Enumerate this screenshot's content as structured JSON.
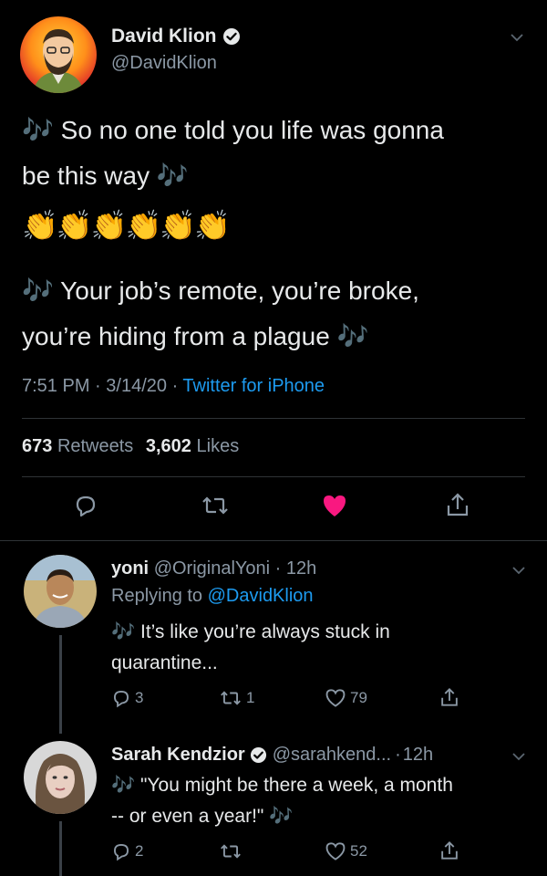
{
  "main_tweet": {
    "author_name": "David Klion",
    "author_handle": "@DavidKlion",
    "line1": "🎶 So no one told you life was gonna",
    "line2": "be this way 🎶",
    "claps": "👏👏👏👏👏👏",
    "line3": "🎶 Your job’s remote, you’re broke,",
    "line4": "you’re hiding from a plague 🎶",
    "time": "7:51 PM",
    "date": "3/14/20",
    "source": "Twitter for iPhone",
    "retweets_count": "673",
    "retweets_label": "Retweets",
    "likes_count": "3,602",
    "likes_label": "Likes"
  },
  "replies": [
    {
      "author_name": "yoni",
      "author_handle": "@OriginalYoni",
      "time": "12h",
      "replying_prefix": "Replying to",
      "replying_to": "@DavidKlion",
      "line1": "🎶 It’s like you’re always stuck in",
      "line2": "quarantine...",
      "reply_count": "3",
      "retweet_count": "1",
      "like_count": "79"
    },
    {
      "author_name": "Sarah Kendzior",
      "author_handle": "@sarahkend...",
      "time": "12h",
      "line1": "🎶 \"You might be there a week, a month",
      "line2": "-- or even a year!\" 🎶",
      "reply_count": "2",
      "retweet_count": "",
      "like_count": "52"
    }
  ],
  "colors": {
    "background": "#000000",
    "link_blue": "#1d9bf0",
    "muted": "#8b98a5",
    "like_red": "#f91880",
    "verified_bg": "#e7e9ea"
  }
}
